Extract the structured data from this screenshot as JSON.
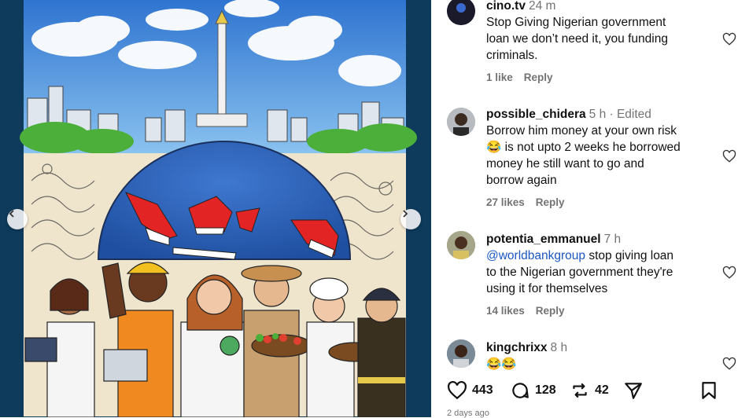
{
  "post_image": {
    "icons": [
      "chevron-left-icon",
      "chevron-right-icon"
    ],
    "colors": {
      "sky": "#3d7fd4",
      "globe": "#2b5fb8",
      "flag_red": "#e02020",
      "frame": "#0e3a5c"
    }
  },
  "comments": [
    {
      "username": "cino.tv",
      "time": "24 m",
      "lines": [
        "Stop Giving Nigerian government",
        "loan we don’t need it, you funding",
        "criminals."
      ],
      "likes": "1 like",
      "reply": "Reply"
    },
    {
      "username": "possible_chidera",
      "time": "5 h · Edited",
      "lines": [
        "Borrow him money at your own risk",
        "😂 is not upto 2 weeks he borrowed",
        "money he still want to go and",
        "borrow again"
      ],
      "likes": "27 likes",
      "reply": "Reply"
    },
    {
      "username": "potentia_emmanuel",
      "time": "7 h",
      "mention": "@worldbankgroup",
      "lines": [
        " stop giving loan",
        "to the Nigerian government they're",
        "using it for themselves"
      ],
      "likes": "14 likes",
      "reply": "Reply"
    },
    {
      "username": "kingchrixx",
      "time": "8 h",
      "lines": [
        "😂😂"
      ]
    }
  ],
  "actions": {
    "likes": "443",
    "comments": "128",
    "reposts": "42",
    "icons": [
      "heart-icon",
      "comment-icon",
      "repost-icon",
      "share-icon",
      "bookmark-icon"
    ]
  },
  "date": "2 days ago"
}
